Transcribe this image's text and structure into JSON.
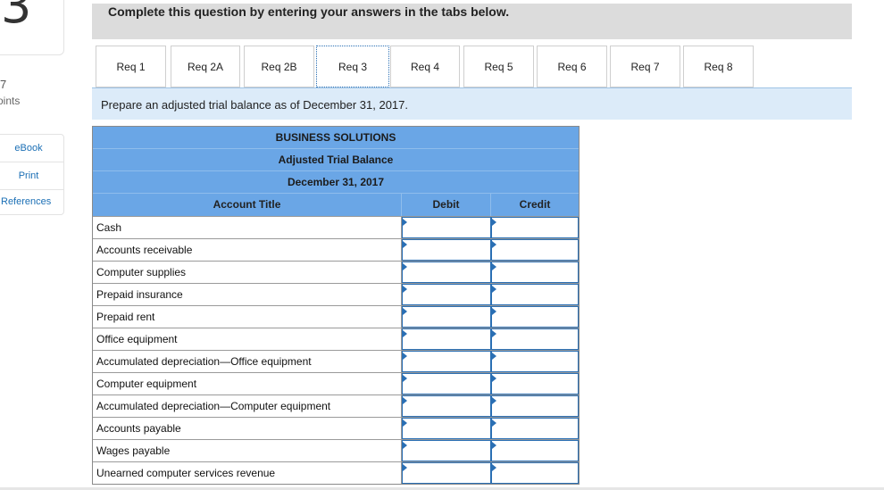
{
  "question": {
    "number": "3",
    "points_value": "7",
    "points_label": "oints"
  },
  "side_links": [
    "eBook",
    "Print",
    "References"
  ],
  "instruction": "Complete this question by entering your answers in the tabs below.",
  "tabs": [
    "Req 1",
    "Req 2A",
    "Req 2B",
    "Req 3",
    "Req 4",
    "Req 5",
    "Req 6",
    "Req 7",
    "Req 8"
  ],
  "active_tab": "Req 3",
  "prompt": "Prepare an adjusted trial balance as of December 31, 2017.",
  "trial_balance": {
    "company": "BUSINESS SOLUTIONS",
    "statement": "Adjusted Trial Balance",
    "date": "December 31, 2017",
    "columns": {
      "account": "Account Title",
      "debit": "Debit",
      "credit": "Credit"
    },
    "accounts": [
      "Cash",
      "Accounts receivable",
      "Computer supplies",
      "Prepaid insurance",
      "Prepaid rent",
      "Office equipment",
      "Accumulated depreciation—Office equipment",
      "Computer equipment",
      "Accumulated depreciation—Computer equipment",
      "Accounts payable",
      "Wages payable",
      "Unearned computer services revenue"
    ]
  }
}
